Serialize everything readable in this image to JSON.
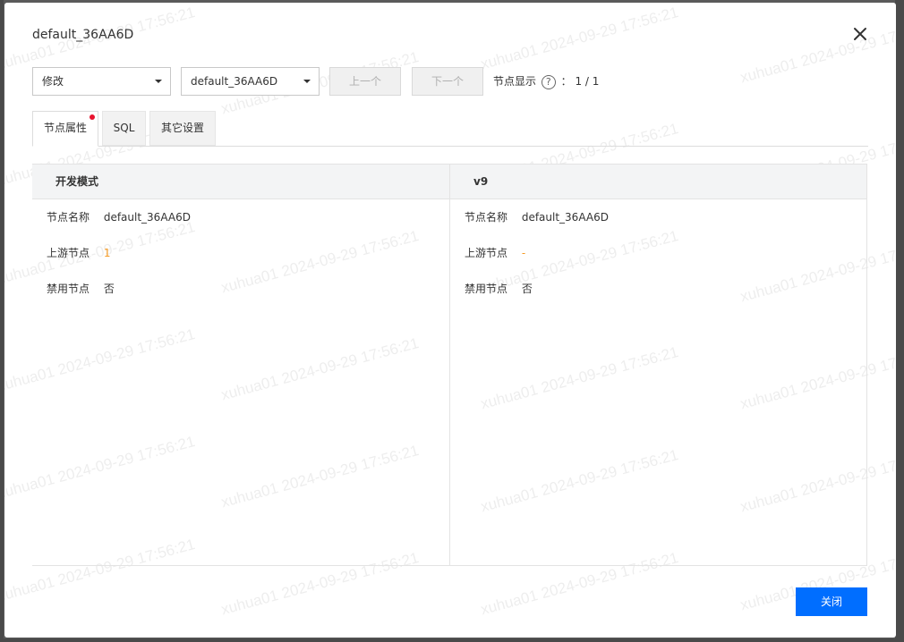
{
  "modal": {
    "title": "default_36AA6D",
    "close_icon": "close-icon"
  },
  "toolbar": {
    "mode_select": "修改",
    "node_select": "default_36AA6D",
    "prev_label": "上一个",
    "next_label": "下一个",
    "node_display_label": "节点显示",
    "help_glyph": "?",
    "node_display_value": "： 1 / 1"
  },
  "tabs": [
    {
      "label": "节点属性",
      "active": true,
      "badge": true
    },
    {
      "label": "SQL",
      "active": false
    },
    {
      "label": "其它设置",
      "active": false
    }
  ],
  "compare": {
    "left": {
      "header": "开发模式",
      "rows": [
        {
          "key": "节点名称",
          "value": "default_36AA6D"
        },
        {
          "key": "上游节点",
          "value": "1"
        },
        {
          "key": "禁用节点",
          "value": "否"
        }
      ]
    },
    "right": {
      "header": "v9",
      "rows": [
        {
          "key": "节点名称",
          "value": "default_36AA6D"
        },
        {
          "key": "上游节点",
          "value": "-"
        },
        {
          "key": "禁用节点",
          "value": "否"
        }
      ]
    }
  },
  "footer": {
    "close_label": "关闭"
  },
  "watermark": {
    "text": "xuhua01 2024-09-29 17:56:21"
  },
  "colors": {
    "primary": "#006eff",
    "badge": "#e8132e",
    "highlight": "#f59a23"
  }
}
